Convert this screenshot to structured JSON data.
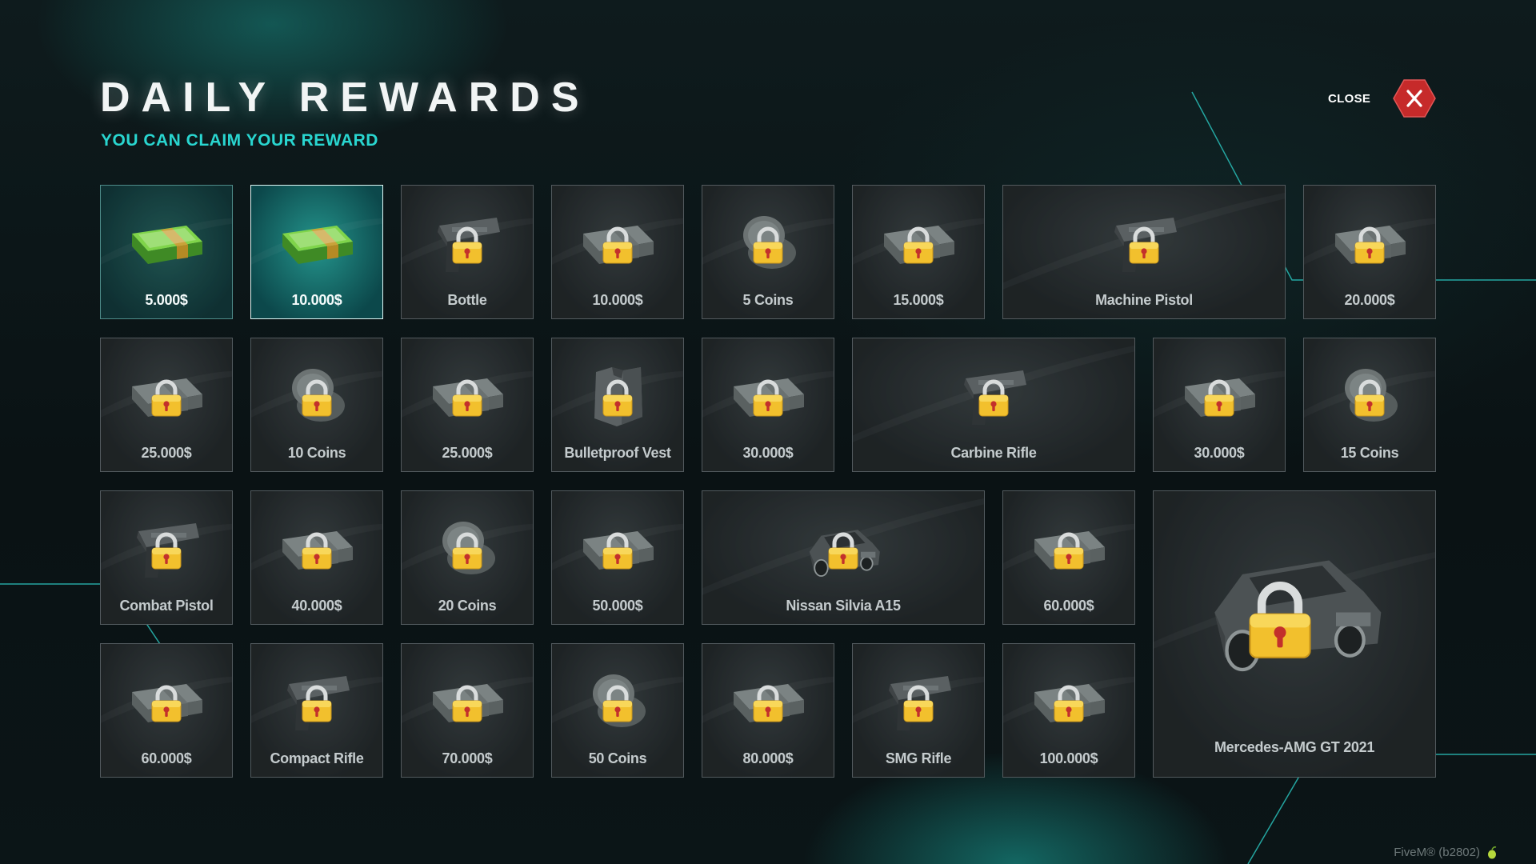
{
  "header": {
    "title": "DAILY REWARDS",
    "subtitle": "YOU CAN CLAIM YOUR REWARD",
    "close_label": "CLOSE"
  },
  "colors": {
    "accent": "#29d6d0",
    "close_red": "#c62a2a",
    "lock_gold": "#f2c02d",
    "tile_border": "#9fb0b4"
  },
  "rewards": [
    {
      "label": "5.000$",
      "icon": "cash-icon",
      "state": "claimed"
    },
    {
      "label": "10.000$",
      "icon": "cash-icon",
      "state": "claimable"
    },
    {
      "label": "Bottle",
      "icon": "pistol-icon",
      "state": "locked"
    },
    {
      "label": "10.000$",
      "icon": "cash-icon",
      "state": "locked"
    },
    {
      "label": "5 Coins",
      "icon": "coins-icon",
      "state": "locked"
    },
    {
      "label": "15.000$",
      "icon": "cash-icon",
      "state": "locked"
    },
    {
      "label": "Machine Pistol",
      "icon": "pistol-icon",
      "state": "locked"
    },
    {
      "label": "20.000$",
      "icon": "cash-icon",
      "state": "locked"
    },
    {
      "label": "25.000$",
      "icon": "cash-icon",
      "state": "locked"
    },
    {
      "label": "10 Coins",
      "icon": "coins-icon",
      "state": "locked"
    },
    {
      "label": "25.000$",
      "icon": "cash-icon",
      "state": "locked"
    },
    {
      "label": "Bulletproof Vest",
      "icon": "vest-icon",
      "state": "locked"
    },
    {
      "label": "30.000$",
      "icon": "cash-icon",
      "state": "locked"
    },
    {
      "label": "Carbine Rifle",
      "icon": "pistol-icon",
      "state": "locked"
    },
    {
      "label": "30.000$",
      "icon": "cash-icon",
      "state": "locked"
    },
    {
      "label": "15 Coins",
      "icon": "coins-icon",
      "state": "locked"
    },
    {
      "label": "Combat Pistol",
      "icon": "pistol-icon",
      "state": "locked"
    },
    {
      "label": "40.000$",
      "icon": "cash-icon",
      "state": "locked"
    },
    {
      "label": "20 Coins",
      "icon": "coins-icon",
      "state": "locked"
    },
    {
      "label": "50.000$",
      "icon": "cash-icon",
      "state": "locked"
    },
    {
      "label": "Nissan Silvia A15",
      "icon": "car-icon",
      "state": "locked"
    },
    {
      "label": "60.000$",
      "icon": "cash-icon",
      "state": "locked"
    },
    {
      "label": "Mercedes-AMG GT 2021",
      "icon": "car-icon",
      "state": "locked"
    },
    {
      "label": "60.000$",
      "icon": "cash-icon",
      "state": "locked"
    },
    {
      "label": "Compact Rifle",
      "icon": "pistol-icon",
      "state": "locked"
    },
    {
      "label": "70.000$",
      "icon": "cash-icon",
      "state": "locked"
    },
    {
      "label": "50 Coins",
      "icon": "coins-icon",
      "state": "locked"
    },
    {
      "label": "80.000$",
      "icon": "cash-icon",
      "state": "locked"
    },
    {
      "label": "SMG Rifle",
      "icon": "pistol-icon",
      "state": "locked"
    },
    {
      "label": "100.000$",
      "icon": "cash-icon",
      "state": "locked"
    }
  ],
  "footer": {
    "build": "FiveM® (b2802)"
  }
}
